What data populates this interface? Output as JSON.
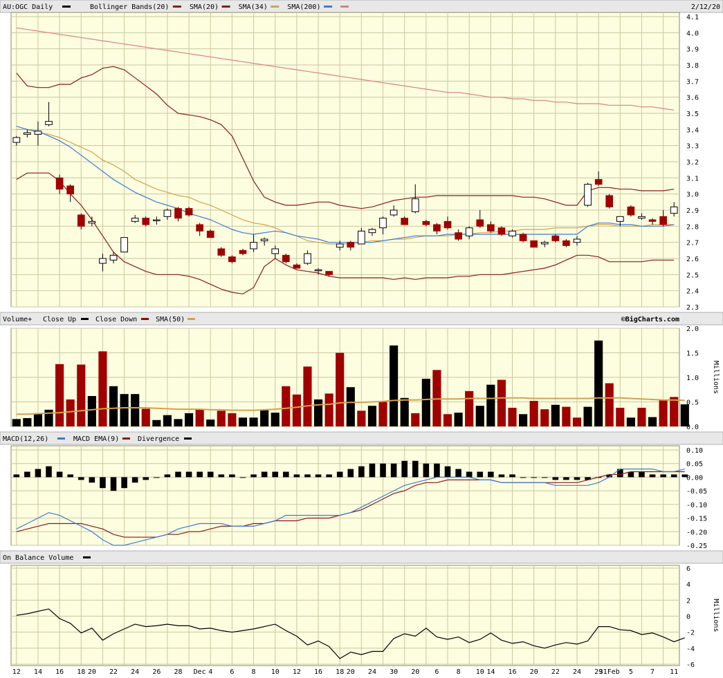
{
  "header": {
    "symbol": "AU:OGC Daily",
    "date": "2/12/20",
    "legend": [
      {
        "label": "Bollinger Bands(20)",
        "color": "#8b1a1a"
      },
      {
        "label": "SMA(20)",
        "color": "#8b1a1a"
      },
      {
        "label": "SMA(34)",
        "color": "#d4a24a"
      },
      {
        "label": "SMA(200)",
        "color": "#3a7bd5"
      },
      {
        "label": "",
        "color": "#d98080"
      }
    ]
  },
  "colors": {
    "panel_bg": "#fdfde0",
    "grid": "#c8c8a0",
    "up": "#000000",
    "down": "#a00000",
    "header_bg": "#e8e8e8"
  },
  "volume_header": {
    "title": "Volume+",
    "close_up": "Close Up",
    "close_down": "Close Down",
    "sma": "SMA(50)",
    "credit": "©BigCharts.com"
  },
  "macd_header": {
    "title": "MACD(12,26)",
    "ema": "MACD EMA(9)",
    "divergence": "Divergence"
  },
  "obv_header": {
    "title": "On Balance Volume"
  },
  "chart_data": [
    {
      "type": "candlestick",
      "title": "AU:OGC Daily",
      "x_labels": [
        "12",
        "14",
        "16",
        "18",
        "20",
        "22",
        "24",
        "26",
        "28",
        "Dec",
        "4",
        "6",
        "8",
        "10",
        "12",
        "16",
        "18",
        "20",
        "24",
        "30",
        "20",
        "6",
        "8",
        "10",
        "14",
        "16",
        "20",
        "22",
        "24",
        "29",
        "31Feb",
        "5",
        "7",
        "11"
      ],
      "ylim": [
        2.3,
        4.1
      ],
      "yticks": [
        2.3,
        2.4,
        2.5,
        2.6,
        2.7,
        2.8,
        2.9,
        3.0,
        3.1,
        3.2,
        3.3,
        3.4,
        3.5,
        3.6,
        3.7,
        3.8,
        3.9,
        4.0,
        4.1
      ],
      "candles": [
        {
          "o": 3.32,
          "h": 3.36,
          "l": 3.3,
          "c": 3.35
        },
        {
          "o": 3.37,
          "h": 3.4,
          "l": 3.35,
          "c": 3.38
        },
        {
          "o": 3.37,
          "h": 3.45,
          "l": 3.3,
          "c": 3.39
        },
        {
          "o": 3.43,
          "h": 3.57,
          "l": 3.42,
          "c": 3.45
        },
        {
          "o": 3.1,
          "h": 3.12,
          "l": 3.0,
          "c": 3.03
        },
        {
          "o": 3.05,
          "h": 3.06,
          "l": 2.95,
          "c": 3.0
        },
        {
          "o": 2.87,
          "h": 2.88,
          "l": 2.78,
          "c": 2.8
        },
        {
          "o": 2.82,
          "h": 2.86,
          "l": 2.8,
          "c": 2.83
        },
        {
          "o": 2.57,
          "h": 2.63,
          "l": 2.52,
          "c": 2.6
        },
        {
          "o": 2.59,
          "h": 2.64,
          "l": 2.57,
          "c": 2.62
        },
        {
          "o": 2.64,
          "h": 2.73,
          "l": 2.64,
          "c": 2.73
        },
        {
          "o": 2.83,
          "h": 2.87,
          "l": 2.82,
          "c": 2.85
        },
        {
          "o": 2.85,
          "h": 2.86,
          "l": 2.8,
          "c": 2.81
        },
        {
          "o": 2.84,
          "h": 2.86,
          "l": 2.81,
          "c": 2.84
        },
        {
          "o": 2.86,
          "h": 2.91,
          "l": 2.84,
          "c": 2.9
        },
        {
          "o": 2.91,
          "h": 2.92,
          "l": 2.83,
          "c": 2.85
        },
        {
          "o": 2.91,
          "h": 2.92,
          "l": 2.86,
          "c": 2.87
        },
        {
          "o": 2.81,
          "h": 2.82,
          "l": 2.74,
          "c": 2.77
        },
        {
          "o": 2.77,
          "h": 2.78,
          "l": 2.73,
          "c": 2.73
        },
        {
          "o": 2.66,
          "h": 2.67,
          "l": 2.61,
          "c": 2.62
        },
        {
          "o": 2.61,
          "h": 2.62,
          "l": 2.57,
          "c": 2.58
        },
        {
          "o": 2.65,
          "h": 2.66,
          "l": 2.62,
          "c": 2.63
        },
        {
          "o": 2.66,
          "h": 2.75,
          "l": 2.64,
          "c": 2.7
        },
        {
          "o": 2.71,
          "h": 2.73,
          "l": 2.68,
          "c": 2.72
        },
        {
          "o": 2.63,
          "h": 2.68,
          "l": 2.6,
          "c": 2.66
        },
        {
          "o": 2.62,
          "h": 2.63,
          "l": 2.57,
          "c": 2.58
        },
        {
          "o": 2.56,
          "h": 2.57,
          "l": 2.54,
          "c": 2.54
        },
        {
          "o": 2.57,
          "h": 2.65,
          "l": 2.56,
          "c": 2.63
        },
        {
          "o": 2.53,
          "h": 2.54,
          "l": 2.5,
          "c": 2.53
        },
        {
          "o": 2.52,
          "h": 2.52,
          "l": 2.49,
          "c": 2.5
        },
        {
          "o": 2.67,
          "h": 2.71,
          "l": 2.65,
          "c": 2.69
        },
        {
          "o": 2.7,
          "h": 2.71,
          "l": 2.65,
          "c": 2.67
        },
        {
          "o": 2.69,
          "h": 2.79,
          "l": 2.69,
          "c": 2.77
        },
        {
          "o": 2.76,
          "h": 2.79,
          "l": 2.74,
          "c": 2.78
        },
        {
          "o": 2.79,
          "h": 2.86,
          "l": 2.75,
          "c": 2.85
        },
        {
          "o": 2.87,
          "h": 2.93,
          "l": 2.86,
          "c": 2.9
        },
        {
          "o": 2.85,
          "h": 2.86,
          "l": 2.81,
          "c": 2.81
        },
        {
          "o": 2.89,
          "h": 3.06,
          "l": 2.88,
          "c": 2.97
        },
        {
          "o": 2.83,
          "h": 2.84,
          "l": 2.8,
          "c": 2.81
        },
        {
          "o": 2.81,
          "h": 2.82,
          "l": 2.75,
          "c": 2.77
        },
        {
          "o": 2.83,
          "h": 2.86,
          "l": 2.78,
          "c": 2.79
        },
        {
          "o": 2.76,
          "h": 2.78,
          "l": 2.71,
          "c": 2.72
        },
        {
          "o": 2.74,
          "h": 2.8,
          "l": 2.72,
          "c": 2.79
        },
        {
          "o": 2.84,
          "h": 2.9,
          "l": 2.79,
          "c": 2.8
        },
        {
          "o": 2.81,
          "h": 2.83,
          "l": 2.76,
          "c": 2.77
        },
        {
          "o": 2.79,
          "h": 2.8,
          "l": 2.74,
          "c": 2.75
        },
        {
          "o": 2.74,
          "h": 2.78,
          "l": 2.73,
          "c": 2.77
        },
        {
          "o": 2.75,
          "h": 2.76,
          "l": 2.7,
          "c": 2.71
        },
        {
          "o": 2.71,
          "h": 2.71,
          "l": 2.67,
          "c": 2.67
        },
        {
          "o": 2.69,
          "h": 2.71,
          "l": 2.67,
          "c": 2.7
        },
        {
          "o": 2.74,
          "h": 2.75,
          "l": 2.7,
          "c": 2.71
        },
        {
          "o": 2.71,
          "h": 2.72,
          "l": 2.67,
          "c": 2.68
        },
        {
          "o": 2.7,
          "h": 2.74,
          "l": 2.68,
          "c": 2.72
        },
        {
          "o": 2.93,
          "h": 3.07,
          "l": 2.92,
          "c": 3.06
        },
        {
          "o": 3.09,
          "h": 3.14,
          "l": 3.05,
          "c": 3.06
        },
        {
          "o": 2.99,
          "h": 3.0,
          "l": 2.91,
          "c": 2.92
        },
        {
          "o": 2.83,
          "h": 2.85,
          "l": 2.8,
          "c": 2.86
        },
        {
          "o": 2.92,
          "h": 2.93,
          "l": 2.86,
          "c": 2.87
        },
        {
          "o": 2.85,
          "h": 2.88,
          "l": 2.84,
          "c": 2.86
        },
        {
          "o": 2.84,
          "h": 2.85,
          "l": 2.81,
          "c": 2.83
        },
        {
          "o": 2.86,
          "h": 2.9,
          "l": 2.8,
          "c": 2.81
        },
        {
          "o": 2.88,
          "h": 2.95,
          "l": 2.86,
          "c": 2.92
        }
      ],
      "bollinger_upper": [
        3.75,
        3.67,
        3.66,
        3.66,
        3.68,
        3.68,
        3.72,
        3.74,
        3.78,
        3.79,
        3.77,
        3.72,
        3.67,
        3.62,
        3.55,
        3.5,
        3.49,
        3.48,
        3.46,
        3.43,
        3.36,
        3.22,
        3.08,
        2.98,
        2.95,
        2.93,
        2.93,
        2.94,
        2.95,
        2.95,
        2.93,
        2.92,
        2.91,
        2.92,
        2.94,
        2.96,
        2.97,
        2.98,
        2.98,
        2.99,
        2.99,
        2.99,
        2.99,
        2.99,
        2.99,
        2.99,
        2.99,
        2.98,
        2.98,
        2.97,
        2.95,
        2.93,
        2.93,
        3.02,
        3.04,
        3.04,
        3.03,
        3.03,
        3.02,
        3.02,
        3.02,
        3.03
      ],
      "bollinger_lower": [
        3.09,
        3.13,
        3.13,
        3.13,
        3.08,
        3.0,
        2.93,
        2.84,
        2.74,
        2.64,
        2.58,
        2.55,
        2.52,
        2.5,
        2.5,
        2.5,
        2.49,
        2.47,
        2.44,
        2.41,
        2.39,
        2.38,
        2.42,
        2.55,
        2.6,
        2.56,
        2.53,
        2.52,
        2.51,
        2.49,
        2.48,
        2.48,
        2.48,
        2.48,
        2.48,
        2.47,
        2.48,
        2.47,
        2.48,
        2.48,
        2.48,
        2.49,
        2.49,
        2.5,
        2.5,
        2.5,
        2.51,
        2.52,
        2.53,
        2.54,
        2.56,
        2.59,
        2.62,
        2.62,
        2.61,
        2.58,
        2.58,
        2.58,
        2.58,
        2.59,
        2.59,
        2.59
      ],
      "sma20": [
        3.42,
        3.4,
        3.39,
        3.36,
        3.33,
        3.29,
        3.24,
        3.19,
        3.14,
        3.09,
        3.05,
        3.01,
        2.98,
        2.95,
        2.93,
        2.91,
        2.88,
        2.86,
        2.84,
        2.81,
        2.78,
        2.76,
        2.75,
        2.76,
        2.77,
        2.76,
        2.74,
        2.73,
        2.72,
        2.7,
        2.7,
        2.7,
        2.7,
        2.7,
        2.71,
        2.72,
        2.73,
        2.74,
        2.74,
        2.74,
        2.75,
        2.75,
        2.75,
        2.75,
        2.75,
        2.75,
        2.75,
        2.75,
        2.75,
        2.75,
        2.75,
        2.75,
        2.75,
        2.8,
        2.82,
        2.82,
        2.81,
        2.81,
        2.8,
        2.8,
        2.8,
        2.81
      ],
      "sma34": [
        3.4,
        3.4,
        3.38,
        3.37,
        3.35,
        3.32,
        3.29,
        3.26,
        3.21,
        3.18,
        3.14,
        3.09,
        3.06,
        3.03,
        3.01,
        2.99,
        2.98,
        2.95,
        2.93,
        2.9,
        2.87,
        2.84,
        2.82,
        2.81,
        2.79,
        2.76,
        2.74,
        2.71,
        2.7,
        2.69,
        2.69,
        2.69,
        2.7,
        2.71,
        2.71,
        2.72,
        2.72,
        2.73,
        2.74,
        2.74,
        2.74,
        2.75,
        2.75,
        2.76,
        2.76,
        2.77,
        2.77,
        2.78,
        2.78,
        2.78,
        2.79,
        2.79,
        2.79,
        2.8,
        2.81,
        2.81,
        2.8,
        2.8,
        2.8,
        2.81,
        2.81,
        2.81
      ],
      "sma200": [
        4.03,
        4.02,
        4.01,
        4.0,
        3.99,
        3.98,
        3.97,
        3.96,
        3.95,
        3.94,
        3.93,
        3.92,
        3.91,
        3.9,
        3.89,
        3.88,
        3.87,
        3.86,
        3.85,
        3.84,
        3.83,
        3.82,
        3.81,
        3.8,
        3.79,
        3.78,
        3.77,
        3.76,
        3.75,
        3.74,
        3.73,
        3.72,
        3.71,
        3.7,
        3.69,
        3.68,
        3.67,
        3.66,
        3.65,
        3.64,
        3.63,
        3.63,
        3.62,
        3.61,
        3.6,
        3.6,
        3.59,
        3.59,
        3.58,
        3.58,
        3.57,
        3.57,
        3.56,
        3.56,
        3.56,
        3.55,
        3.55,
        3.55,
        3.54,
        3.54,
        3.53,
        3.52
      ]
    },
    {
      "type": "bar",
      "title": "Volume+",
      "ylabel": "Millions",
      "ylim": [
        0,
        2.0
      ],
      "yticks": [
        0.0,
        0.5,
        1.0,
        1.5,
        2.0
      ],
      "values": [
        0.15,
        0.17,
        0.25,
        0.34,
        1.27,
        0.55,
        1.26,
        0.62,
        1.53,
        0.82,
        0.66,
        0.66,
        0.36,
        0.13,
        0.23,
        0.15,
        0.27,
        0.35,
        0.14,
        0.32,
        0.27,
        0.18,
        0.18,
        0.33,
        0.28,
        0.82,
        0.65,
        1.22,
        0.55,
        0.67,
        1.5,
        0.8,
        0.32,
        0.42,
        0.5,
        1.65,
        0.58,
        0.27,
        0.97,
        1.15,
        0.25,
        0.28,
        0.72,
        0.42,
        0.85,
        0.95,
        0.38,
        0.25,
        0.52,
        0.35,
        0.44,
        0.4,
        0.18,
        0.4,
        1.75,
        0.88,
        0.38,
        0.18,
        0.38,
        0.19,
        0.53,
        0.6,
        0.45
      ],
      "up": [
        true,
        true,
        true,
        true,
        false,
        false,
        false,
        true,
        false,
        true,
        true,
        true,
        false,
        true,
        true,
        true,
        true,
        false,
        true,
        false,
        false,
        true,
        true,
        true,
        true,
        false,
        false,
        false,
        true,
        false,
        false,
        true,
        false,
        true,
        false,
        true,
        true,
        false,
        true,
        false,
        false,
        true,
        false,
        true,
        true,
        false,
        false,
        true,
        false,
        false,
        true,
        false,
        false,
        true,
        true,
        false,
        false,
        true,
        false,
        true,
        false,
        false,
        true
      ],
      "sma50": [
        0.25,
        0.25,
        0.26,
        0.27,
        0.28,
        0.3,
        0.32,
        0.34,
        0.36,
        0.37,
        0.38,
        0.38,
        0.38,
        0.37,
        0.36,
        0.35,
        0.35,
        0.35,
        0.34,
        0.34,
        0.33,
        0.33,
        0.33,
        0.34,
        0.35,
        0.37,
        0.39,
        0.42,
        0.44,
        0.45,
        0.48,
        0.49,
        0.49,
        0.5,
        0.51,
        0.53,
        0.54,
        0.54,
        0.55,
        0.56,
        0.56,
        0.56,
        0.57,
        0.57,
        0.57,
        0.58,
        0.58,
        0.58,
        0.57,
        0.57,
        0.57,
        0.57,
        0.57,
        0.57,
        0.58,
        0.58,
        0.58,
        0.57,
        0.56,
        0.55,
        0.54,
        0.54,
        0.53
      ]
    },
    {
      "type": "line",
      "title": "MACD(12,26)",
      "ylim": [
        -0.25,
        0.1
      ],
      "yticks": [
        -0.25,
        -0.2,
        -0.15,
        -0.1,
        -0.05,
        0.0,
        0.05,
        0.1
      ],
      "macd": [
        -0.19,
        -0.17,
        -0.15,
        -0.13,
        -0.14,
        -0.16,
        -0.18,
        -0.2,
        -0.23,
        -0.25,
        -0.25,
        -0.24,
        -0.23,
        -0.22,
        -0.21,
        -0.19,
        -0.18,
        -0.17,
        -0.17,
        -0.17,
        -0.18,
        -0.18,
        -0.18,
        -0.17,
        -0.16,
        -0.14,
        -0.14,
        -0.14,
        -0.14,
        -0.14,
        -0.14,
        -0.13,
        -0.11,
        -0.09,
        -0.07,
        -0.05,
        -0.03,
        -0.02,
        -0.01,
        0.0,
        0.0,
        0.0,
        0.0,
        -0.01,
        -0.01,
        -0.02,
        -0.02,
        -0.02,
        -0.02,
        -0.02,
        -0.03,
        -0.03,
        -0.03,
        -0.03,
        -0.02,
        0.0,
        0.03,
        0.03,
        0.03,
        0.03,
        0.02,
        0.02,
        0.03
      ],
      "ema": [
        -0.2,
        -0.19,
        -0.18,
        -0.17,
        -0.17,
        -0.17,
        -0.17,
        -0.18,
        -0.19,
        -0.21,
        -0.22,
        -0.22,
        -0.22,
        -0.22,
        -0.21,
        -0.21,
        -0.2,
        -0.2,
        -0.19,
        -0.18,
        -0.18,
        -0.18,
        -0.17,
        -0.17,
        -0.16,
        -0.16,
        -0.16,
        -0.15,
        -0.15,
        -0.15,
        -0.14,
        -0.13,
        -0.12,
        -0.1,
        -0.08,
        -0.06,
        -0.05,
        -0.03,
        -0.02,
        -0.02,
        -0.01,
        -0.01,
        -0.01,
        -0.01,
        -0.01,
        -0.02,
        -0.02,
        -0.02,
        -0.02,
        -0.02,
        -0.02,
        -0.02,
        -0.02,
        -0.01,
        0.0,
        0.01,
        0.01,
        0.02,
        0.02,
        0.02,
        0.02,
        0.02,
        0.02
      ],
      "divergence": [
        0.01,
        0.02,
        0.03,
        0.04,
        0.02,
        0.01,
        -0.01,
        -0.02,
        -0.04,
        -0.05,
        -0.04,
        -0.02,
        -0.01,
        0.0,
        0.01,
        0.02,
        0.02,
        0.02,
        0.02,
        0.01,
        0.01,
        0.0,
        0.01,
        0.02,
        0.02,
        0.02,
        0.01,
        0.01,
        0.01,
        0.01,
        0.02,
        0.03,
        0.04,
        0.05,
        0.05,
        0.05,
        0.06,
        0.06,
        0.05,
        0.05,
        0.04,
        0.03,
        0.02,
        0.02,
        0.02,
        0.01,
        0.01,
        0.0,
        0.0,
        0.0,
        -0.01,
        -0.01,
        -0.01,
        -0.01,
        0.0,
        0.01,
        0.03,
        0.02,
        0.02,
        0.01,
        0.01,
        0.01,
        0.01
      ]
    },
    {
      "type": "line",
      "title": "On Balance Volume",
      "ylabel": "Millions",
      "ylim": [
        -6,
        6
      ],
      "yticks": [
        -6,
        -4,
        -2,
        0,
        2,
        4,
        6
      ],
      "obv": [
        0.1,
        0.3,
        0.6,
        0.9,
        -0.3,
        -0.9,
        -2.1,
        -1.5,
        -3.0,
        -2.2,
        -1.6,
        -1.0,
        -1.3,
        -1.2,
        -1.0,
        -1.2,
        -1.2,
        -1.6,
        -1.5,
        -1.8,
        -2.0,
        -1.8,
        -1.6,
        -1.3,
        -1.0,
        -1.8,
        -2.5,
        -3.6,
        -3.1,
        -3.8,
        -5.3,
        -4.5,
        -4.8,
        -4.4,
        -4.4,
        -2.8,
        -2.2,
        -2.5,
        -1.5,
        -2.6,
        -2.9,
        -2.6,
        -3.3,
        -2.9,
        -2.1,
        -3.0,
        -3.4,
        -3.2,
        -3.7,
        -4.0,
        -3.6,
        -3.3,
        -3.5,
        -3.1,
        -1.3,
        -1.3,
        -1.7,
        -1.8,
        -2.3,
        -2.1,
        -2.6,
        -3.2,
        -2.7
      ]
    }
  ]
}
